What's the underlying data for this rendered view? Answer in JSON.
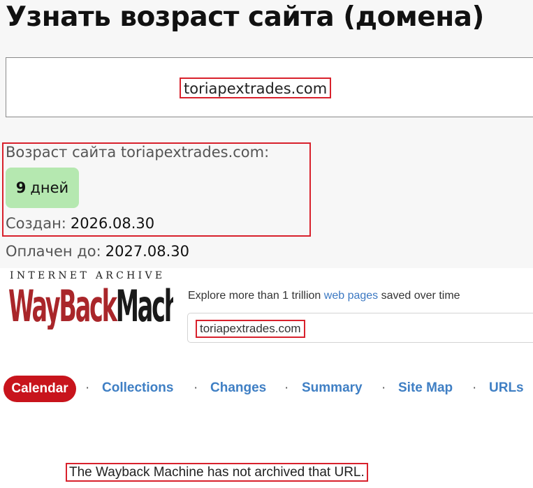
{
  "checker": {
    "title": "Узнать возраст сайта (домена)",
    "input_value": "toriapextrades.com",
    "age_label": "Возраст сайта toriapextrades.com:",
    "age_number": "9",
    "age_unit": "дней",
    "created_label": "Создан:",
    "created_value": "2026.08.30",
    "paid_label": "Оплачен до:",
    "paid_value": "2027.08.30"
  },
  "wayback": {
    "header_label": "INTERNET ARCHIVE",
    "logo_text": "WaybackMachine",
    "tagline_before": "Explore more than 1 trillion ",
    "tagline_link": "web pages",
    "tagline_after": " saved over time",
    "search_value": "toriapextrades.com",
    "nav": {
      "calendar": "Calendar",
      "separator": "·",
      "collections": "Collections",
      "changes": "Changes",
      "summary": "Summary",
      "site_map": "Site Map",
      "urls": "URLs"
    },
    "message": "The Wayback Machine has not archived that URL."
  },
  "colors": {
    "highlight_border": "#d8212c",
    "age_badge_bg": "#b5e8b0",
    "wayback_red": "#a9262a",
    "link_blue": "#3f7fc4",
    "calendar_red": "#c8141c"
  }
}
